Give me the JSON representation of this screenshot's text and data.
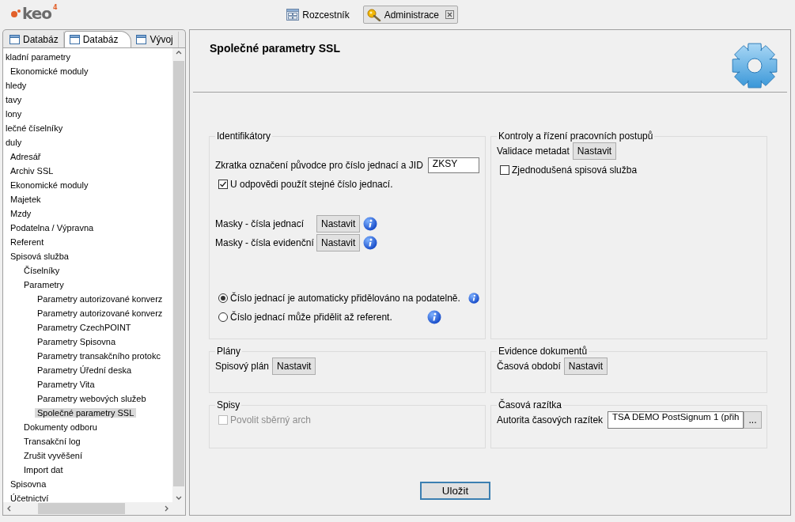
{
  "app": {
    "logo": "keo",
    "logo_mark": "4"
  },
  "perspectives": [
    {
      "label": "Rozcestník",
      "selected": false,
      "closable": false
    },
    {
      "label": "Administrace",
      "selected": true,
      "closable": true
    }
  ],
  "sidebar": {
    "tabs": [
      {
        "label": "Databáz",
        "selected": false
      },
      {
        "label": "Databáz",
        "selected": true
      },
      {
        "label": "Vývoj",
        "selected": false
      }
    ],
    "tree": [
      {
        "label": "kladní parametry",
        "selected": false,
        "children": [
          {
            "label": "Ekonomické moduly",
            "selected": false
          }
        ]
      },
      {
        "label": "hledy",
        "selected": false
      },
      {
        "label": "tavy",
        "selected": false
      },
      {
        "label": "lony",
        "selected": false
      },
      {
        "label": "lečné číselníky",
        "selected": false
      },
      {
        "label": "duly",
        "selected": false,
        "children": [
          {
            "label": "Adresář",
            "selected": false
          },
          {
            "label": "Archiv SSL",
            "selected": false
          },
          {
            "label": "Ekonomické moduly",
            "selected": false
          },
          {
            "label": "Majetek",
            "selected": false
          },
          {
            "label": "Mzdy",
            "selected": false
          },
          {
            "label": "Podatelna / Výpravna",
            "selected": false
          },
          {
            "label": "Referent",
            "selected": false
          },
          {
            "label": "Spisová služba",
            "selected": false,
            "children": [
              {
                "label": "Číselníky",
                "selected": false
              },
              {
                "label": "Parametry",
                "selected": false,
                "children": [
                  {
                    "label": "Parametry autorizované konverz",
                    "selected": false
                  },
                  {
                    "label": "Parametry autorizované konverz",
                    "selected": false
                  },
                  {
                    "label": "Parametry CzechPOINT",
                    "selected": false
                  },
                  {
                    "label": "Parametry Spisovna",
                    "selected": false
                  },
                  {
                    "label": "Parametry transakčního protokc",
                    "selected": false
                  },
                  {
                    "label": "Parametry Úřední deska",
                    "selected": false
                  },
                  {
                    "label": "Parametry Vita",
                    "selected": false
                  },
                  {
                    "label": "Parametry webových služeb",
                    "selected": false
                  },
                  {
                    "label": "Společné parametry SSL",
                    "selected": true
                  }
                ]
              },
              {
                "label": "Dokumenty odboru",
                "selected": false
              },
              {
                "label": "Transakční log",
                "selected": false
              },
              {
                "label": "Zrušit vyvěšení",
                "selected": false
              },
              {
                "label": "Import dat",
                "selected": false
              }
            ]
          },
          {
            "label": "Spisovna",
            "selected": false
          },
          {
            "label": "Účetnictví",
            "selected": false
          }
        ]
      }
    ]
  },
  "editor": {
    "title": "Společné parametry SSL",
    "groups": [
      {
        "title": "Identifikátory",
        "rows": [
          {
            "kind": "field",
            "label": "Zkratka označení původce pro číslo jednací a JID",
            "value": "ZKSY"
          },
          {
            "kind": "checkbox",
            "label": "U odpovědi použít stejné číslo jednací.",
            "checked": true,
            "disabled": false
          },
          {
            "kind": "setting",
            "label": "Masky - čísla jednací",
            "button": "Nastavit",
            "info": true
          },
          {
            "kind": "setting",
            "label": "Masky - čísla evidenční",
            "button": "Nastavit",
            "info": true
          },
          {
            "kind": "radio",
            "label": "Číslo jednací je automaticky přidělováno na podatelně.",
            "selected": true,
            "info": true
          },
          {
            "kind": "radio",
            "label": "Číslo jednací může přidělit až referent.",
            "selected": false,
            "info": true
          }
        ]
      },
      {
        "title": "Kontroly a řízení pracovních postupů",
        "rows": [
          {
            "kind": "setting",
            "label": "Validace metadat",
            "button": "Nastavit",
            "info": false
          },
          {
            "kind": "checkbox",
            "label": "Zjednodušená spisová služba",
            "checked": false,
            "disabled": false
          }
        ]
      },
      {
        "title": "Plány",
        "rows": [
          {
            "kind": "setting",
            "label": "Spisový plán",
            "button": "Nastavit",
            "info": false
          }
        ]
      },
      {
        "title": "Evidence dokumentů",
        "rows": [
          {
            "kind": "setting",
            "label": "Časová období",
            "button": "Nastavit",
            "info": false
          }
        ]
      },
      {
        "title": "Spisy",
        "rows": [
          {
            "kind": "checkbox",
            "label": "Povolit sběrný arch",
            "checked": false,
            "disabled": true
          }
        ]
      },
      {
        "title": "Časová razítka",
        "rows": [
          {
            "kind": "picker",
            "label": "Autorita časových razítek",
            "value": "TSA DEMO PostSignum 1 (přih",
            "button": "..."
          }
        ]
      }
    ],
    "save_button": "Uložit"
  }
}
